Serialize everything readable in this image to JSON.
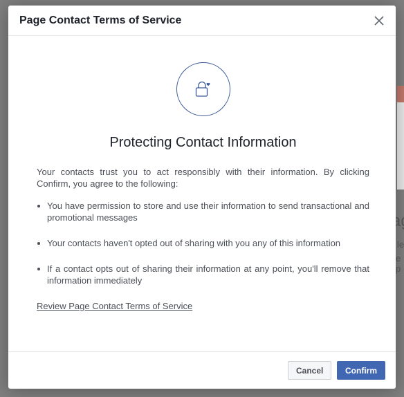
{
  "background": {
    "side_text_1": "ag",
    "side_text_2": "le",
    "side_text_3": "e p"
  },
  "dialog": {
    "title": "Page Contact Terms of Service",
    "heading": "Protecting Contact Information",
    "intro": "Your contacts trust you to act responsibly with their information. By clicking Confirm, you agree to the following:",
    "terms": [
      "You have permission to store and use their information to send transactional and promotional messages",
      "Your contacts haven't opted out of sharing with you any of this information",
      "If a contact opts out of sharing their information at any point, you'll remove that information immediately"
    ],
    "review_link": "Review Page Contact Terms of Service",
    "cancel_label": "Cancel",
    "confirm_label": "Confirm"
  },
  "icons": {
    "close": "close-icon",
    "lock": "lock-heart-icon"
  },
  "colors": {
    "accent": "#4267b2",
    "icon_stroke": "#3b5998",
    "overlay": "#7f7f7f"
  }
}
